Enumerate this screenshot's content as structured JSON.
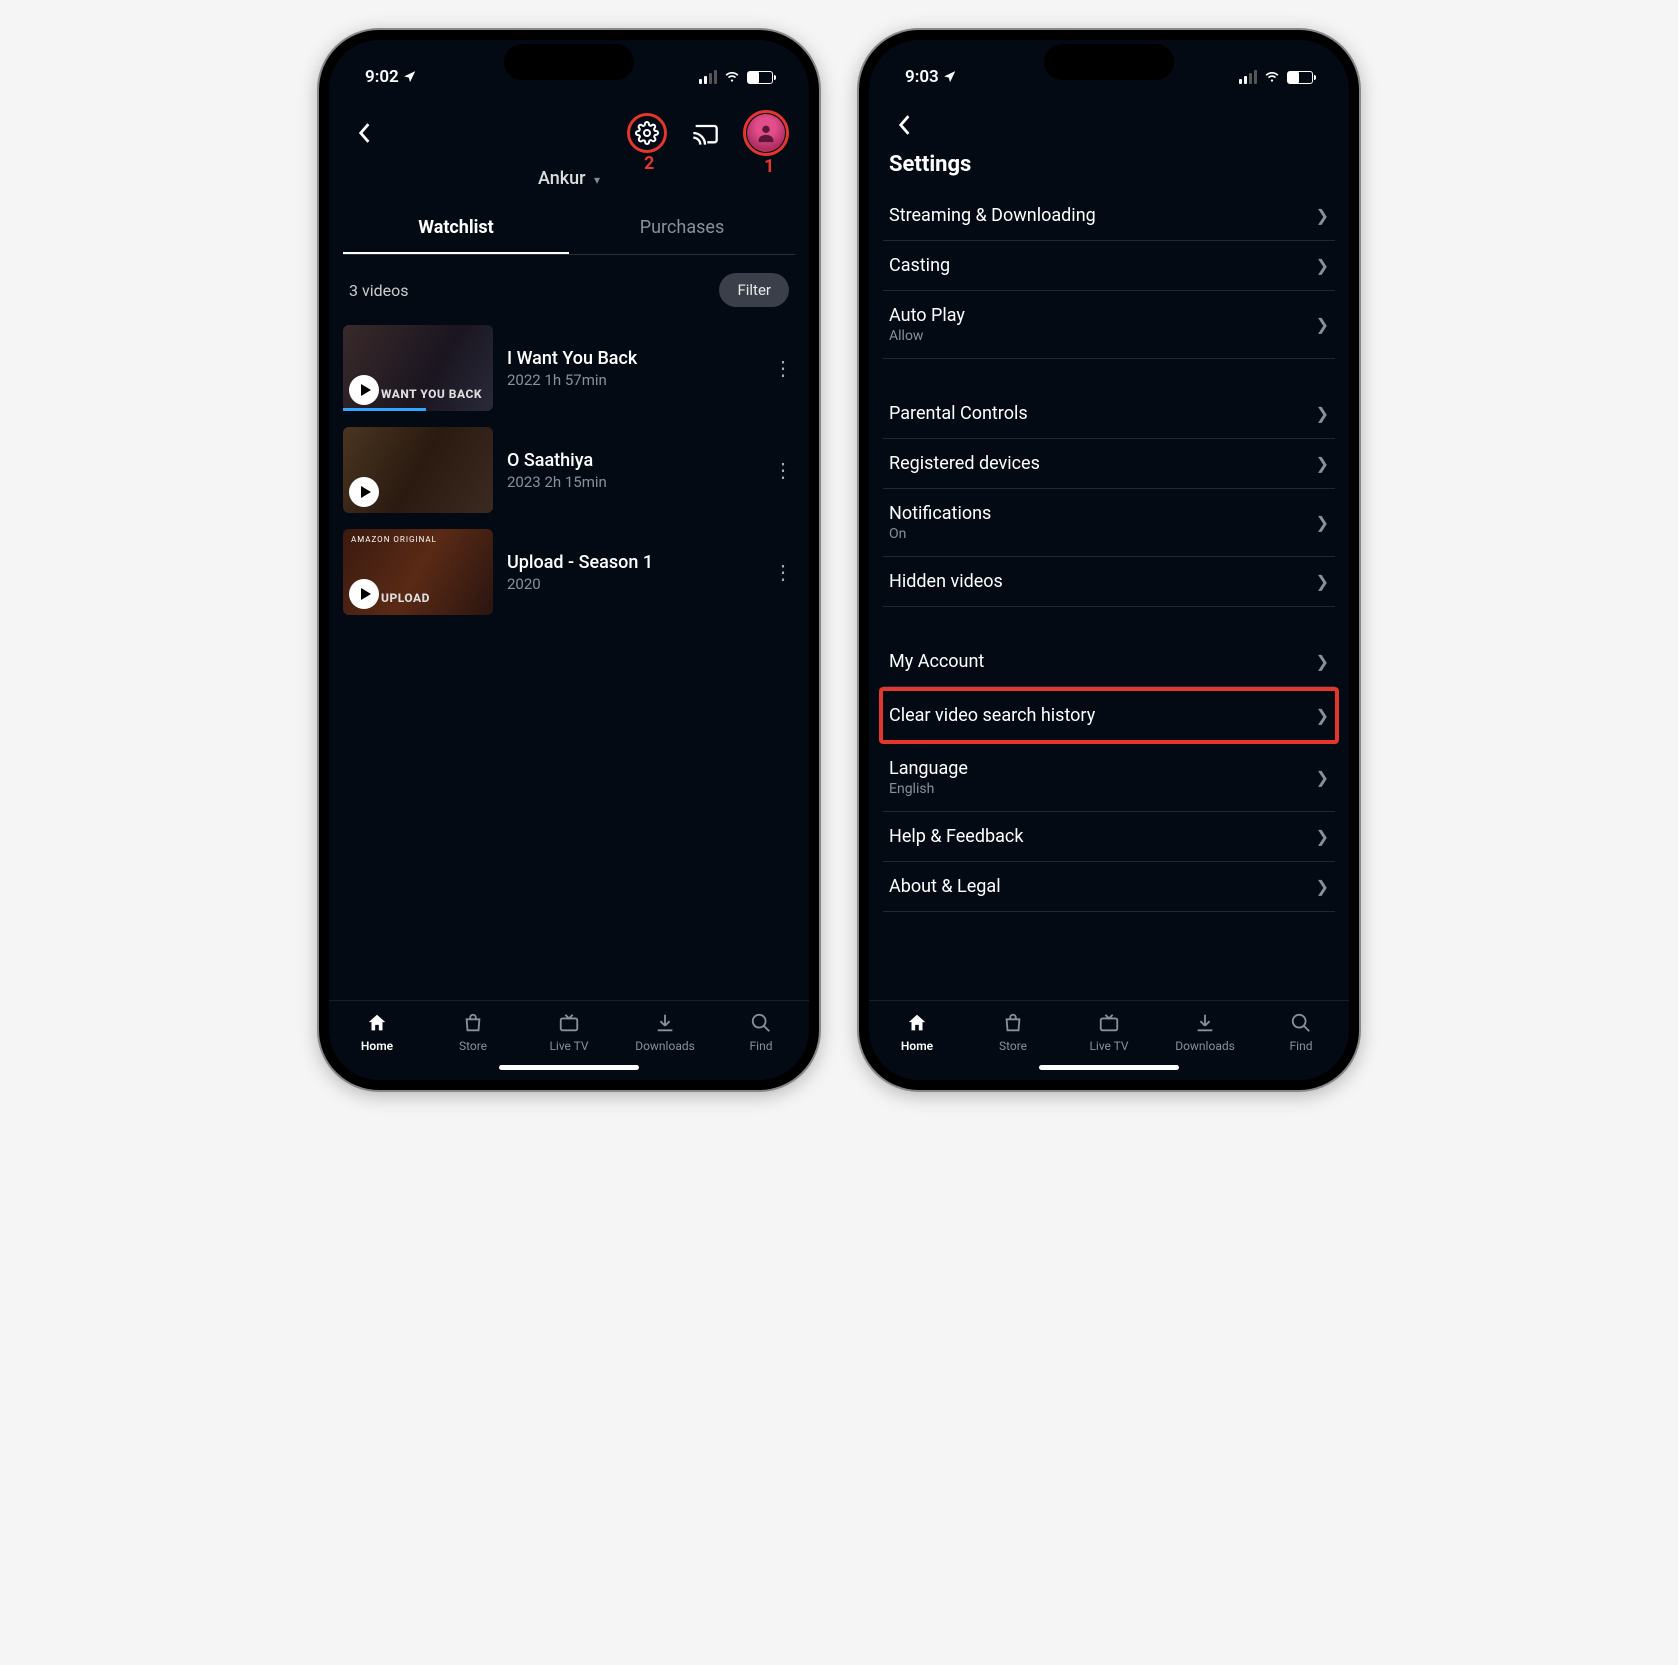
{
  "phone1": {
    "time": "9:02",
    "profile_name": "Ankur",
    "annotations": {
      "settings": "2",
      "avatar": "1"
    },
    "tabs": {
      "watchlist": "Watchlist",
      "purchases": "Purchases"
    },
    "video_count": "3 videos",
    "filter_label": "Filter",
    "videos": [
      {
        "title": "I Want You Back",
        "meta": "2022 1h 57min",
        "progress": 55,
        "overlay": "WANT YOU BACK"
      },
      {
        "title": "O Saathiya",
        "meta": "2023 2h 15min",
        "progress": 0,
        "overlay": ""
      },
      {
        "title": "Upload - Season 1",
        "meta": "2020",
        "progress": 0,
        "badge": "AMAZON ORIGINAL",
        "overlay": "UPLOAD"
      }
    ]
  },
  "phone2": {
    "time": "9:03",
    "title": "Settings",
    "groups": [
      [
        {
          "label": "Streaming & Downloading",
          "sub": ""
        },
        {
          "label": "Casting",
          "sub": ""
        },
        {
          "label": "Auto Play",
          "sub": "Allow"
        }
      ],
      [
        {
          "label": "Parental Controls",
          "sub": ""
        },
        {
          "label": "Registered devices",
          "sub": ""
        },
        {
          "label": "Notifications",
          "sub": "On"
        },
        {
          "label": "Hidden videos",
          "sub": ""
        }
      ],
      [
        {
          "label": "My Account",
          "sub": ""
        },
        {
          "label": "Clear video search history",
          "sub": "",
          "highlight": true
        },
        {
          "label": "Language",
          "sub": "English"
        },
        {
          "label": "Help & Feedback",
          "sub": ""
        },
        {
          "label": "About & Legal",
          "sub": ""
        }
      ]
    ]
  },
  "tabbar": {
    "items": [
      {
        "label": "Home",
        "icon": "home"
      },
      {
        "label": "Store",
        "icon": "bag"
      },
      {
        "label": "Live TV",
        "icon": "tv"
      },
      {
        "label": "Downloads",
        "icon": "download"
      },
      {
        "label": "Find",
        "icon": "search"
      }
    ]
  }
}
